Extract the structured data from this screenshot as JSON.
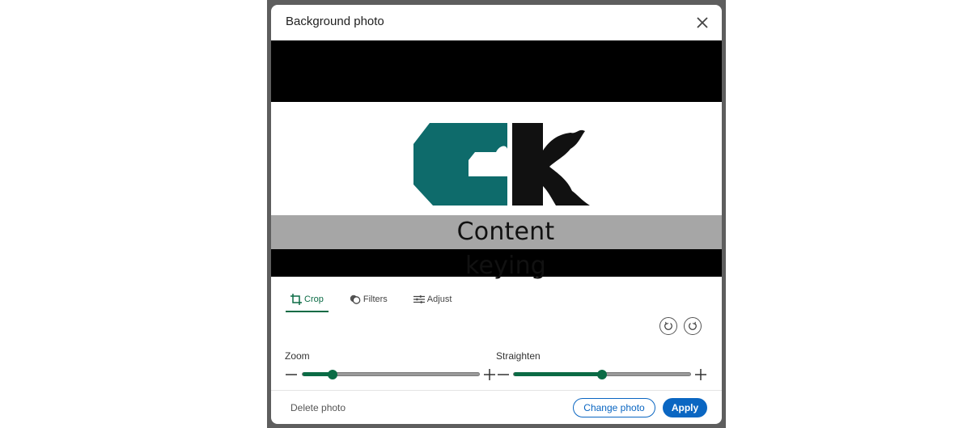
{
  "modal": {
    "title": "Background photo",
    "close_icon": "close-icon"
  },
  "photo": {
    "logo_text": "Content keying",
    "brand_teal": "#0e6b6b",
    "brand_black": "#111111"
  },
  "tabs": [
    {
      "label": "Crop",
      "icon": "crop-icon",
      "active": true
    },
    {
      "label": "Filters",
      "icon": "filters-icon",
      "active": false
    },
    {
      "label": "Adjust",
      "icon": "adjust-icon",
      "active": false
    }
  ],
  "rotate": {
    "left_icon": "rotate-left-icon",
    "right_icon": "rotate-right-icon"
  },
  "zoom": {
    "label": "Zoom",
    "value_fraction": 0.17
  },
  "straighten": {
    "label": "Straighten",
    "value_fraction": 0.5
  },
  "footer": {
    "delete_label": "Delete photo",
    "change_label": "Change photo",
    "apply_label": "Apply"
  },
  "colors": {
    "accent_green": "#0b6b45",
    "link_blue": "#0a66c2"
  }
}
